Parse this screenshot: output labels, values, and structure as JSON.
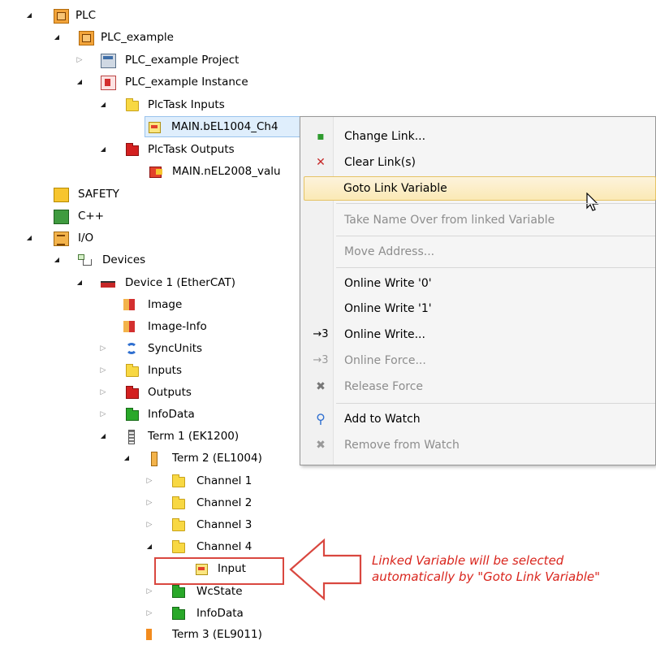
{
  "tree": {
    "plc": "PLC",
    "plc_example": "PLC_example",
    "plc_example_project": "PLC_example Project",
    "plc_example_instance": "PLC_example Instance",
    "plctask_inputs": "PlcTask Inputs",
    "main_bel1004": "MAIN.bEL1004_Ch4",
    "plctask_outputs": "PlcTask Outputs",
    "main_nel2008": "MAIN.nEL2008_valu",
    "safety": "SAFETY",
    "cpp": "C++",
    "io": "I/O",
    "devices": "Devices",
    "device1": "Device 1 (EtherCAT)",
    "image": "Image",
    "image_info": "Image-Info",
    "syncunits": "SyncUnits",
    "inputs": "Inputs",
    "outputs": "Outputs",
    "infodata": "InfoData",
    "term1": "Term 1 (EK1200)",
    "term2": "Term 2 (EL1004)",
    "channel1": "Channel 1",
    "channel2": "Channel 2",
    "channel3": "Channel 3",
    "channel4": "Channel 4",
    "input": "Input",
    "wcstate": "WcState",
    "infodata2": "InfoData",
    "term3": "Term 3 (EL9011)"
  },
  "context_menu": {
    "change_link": "Change Link...",
    "clear_links": "Clear Link(s)",
    "goto_link_variable": "Goto Link Variable",
    "take_name_over": "Take Name Over from linked Variable",
    "move_address": "Move Address...",
    "online_write_0": "Online Write '0'",
    "online_write_1": "Online Write '1'",
    "online_write": "Online Write...",
    "online_force": "Online Force...",
    "release_force": "Release Force",
    "add_to_watch": "Add to Watch",
    "remove_from_watch": "Remove from Watch",
    "online_write_icon_glyph": "→3",
    "online_force_icon_glyph": "→3"
  },
  "annotation": {
    "line1": "Linked Variable will be selected",
    "line2": "automatically by \"Goto Link Variable\""
  },
  "colors": {
    "accent_red": "#d9251d",
    "hover_bg": "#fbe9b5",
    "selection_bg": "#dfeefc"
  }
}
